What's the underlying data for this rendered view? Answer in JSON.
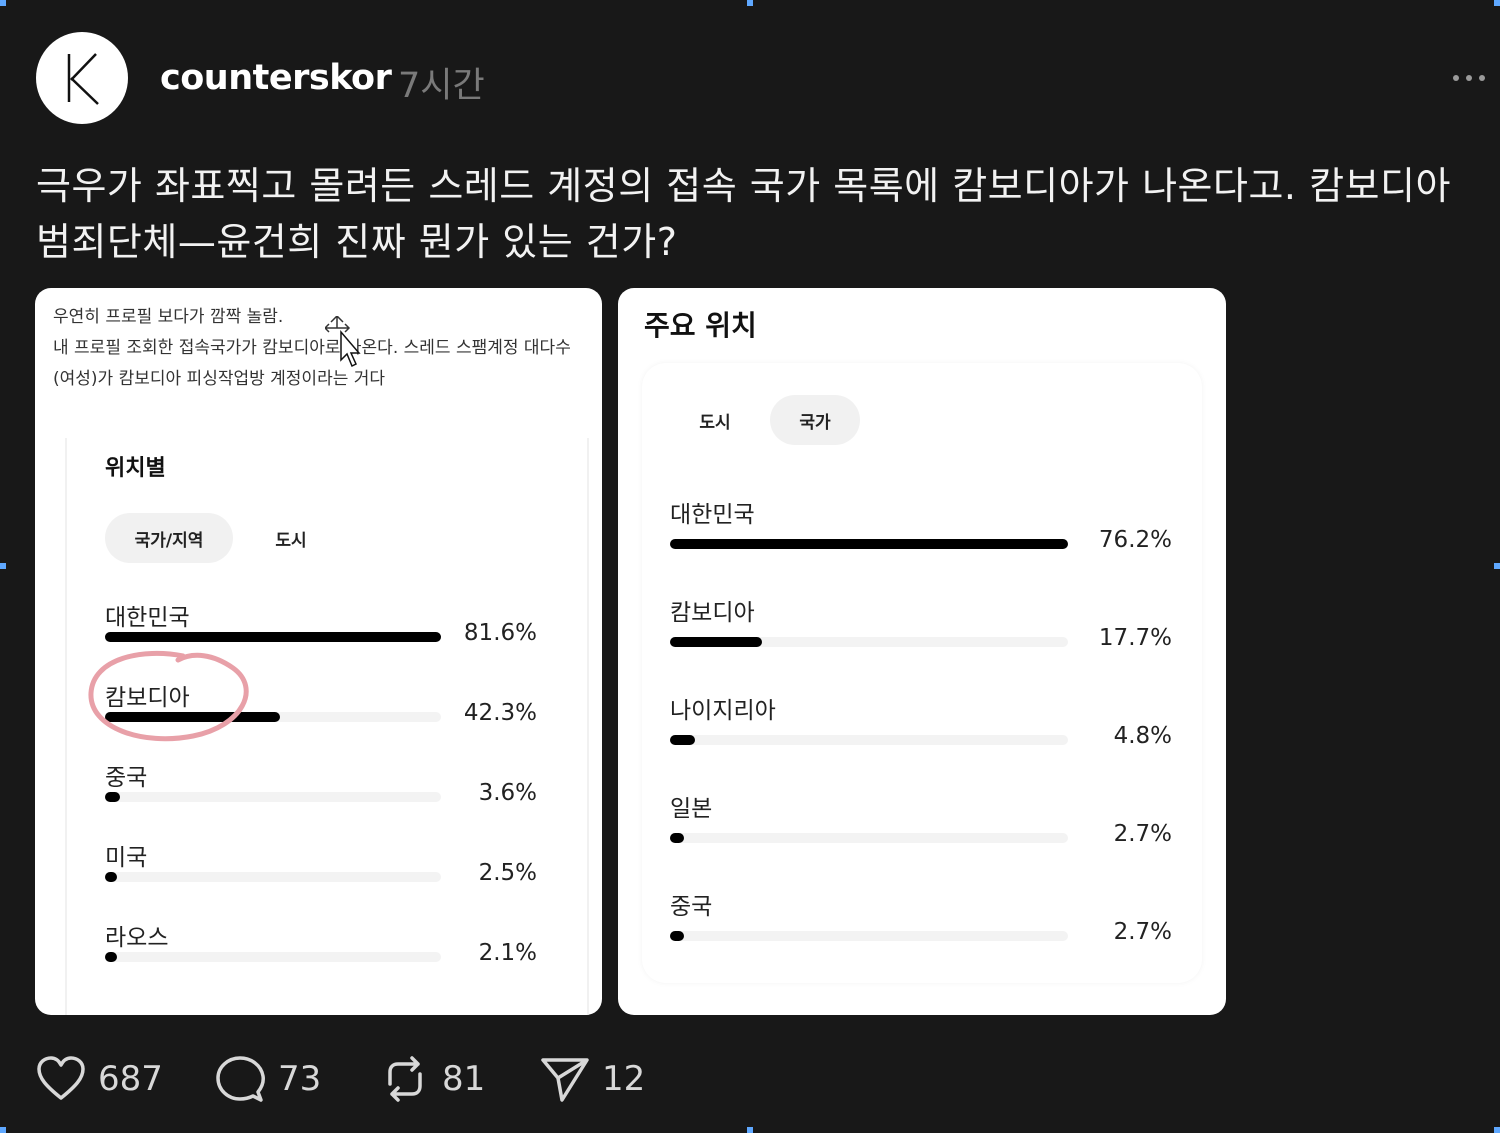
{
  "post": {
    "username": "counterskor",
    "timestamp": "7시간",
    "avatar_letter": "K",
    "text": "극우가 좌표찍고 몰려든 스레드 계정의 접속 국가 목록에 캄보디아가 나온다고. 캄보디아 범죄단체—윤건희 진짜 뭔가 있는 건가?"
  },
  "left_image": {
    "caption": "우연히 프로필 보다가 깜짝 놀람.\n내 프로필 조회한 접속국가가 캄보디아로 나온다. 스레드 스팸계정 대다수(여성)가 캄보디아 피싱작업방 계정이라는 거다",
    "panel_title": "위치별",
    "tabs": [
      "국가/지역",
      "도시"
    ],
    "active_tab_index": 0,
    "rows": [
      {
        "label": "대한민국",
        "value": "81.6%",
        "fraction": 1.0
      },
      {
        "label": "캄보디아",
        "value": "42.3%",
        "fraction": 0.52
      },
      {
        "label": "중국",
        "value": "3.6%",
        "fraction": 0.044
      },
      {
        "label": "미국",
        "value": "2.5%",
        "fraction": 0.031
      },
      {
        "label": "라오스",
        "value": "2.1%",
        "fraction": 0.026
      }
    ]
  },
  "right_image": {
    "panel_title": "주요 위치",
    "tabs": [
      "도시",
      "국가"
    ],
    "active_tab_index": 1,
    "rows": [
      {
        "label": "대한민국",
        "value": "76.2%",
        "fraction": 1.0
      },
      {
        "label": "캄보디아",
        "value": "17.7%",
        "fraction": 0.232
      },
      {
        "label": "나이지리아",
        "value": "4.8%",
        "fraction": 0.063
      },
      {
        "label": "일본",
        "value": "2.7%",
        "fraction": 0.035
      },
      {
        "label": "중국",
        "value": "2.7%",
        "fraction": 0.035
      }
    ]
  },
  "actions": {
    "likes": "687",
    "comments": "73",
    "reposts": "81",
    "shares": "12"
  },
  "icons": {
    "like": "heart-icon",
    "comment": "comment-bubble-icon",
    "repost": "repost-icon",
    "share": "send-icon",
    "more": "more-dots-icon"
  },
  "colors": {
    "background": "#181818",
    "text": "#f2f2f2",
    "muted": "#7a7a7a",
    "bar": "#000000",
    "annotation": "#e8a0a8"
  }
}
